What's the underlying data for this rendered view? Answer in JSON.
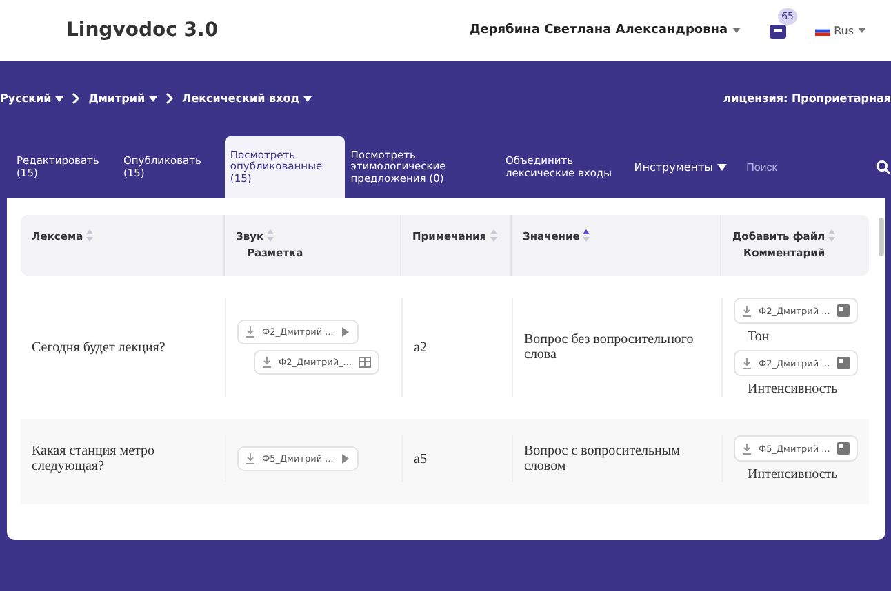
{
  "header": {
    "logo": "Lingvodoc 3.0",
    "user": "Дерябина Светлана Александровна",
    "notifications": "65",
    "language": "Rus"
  },
  "breadcrumbs": [
    "Русский",
    "Дмитрий",
    "Лексический вход"
  ],
  "license": "лицензия: Проприетарная",
  "tabs": [
    {
      "label": "Редактировать (15)",
      "selected": false
    },
    {
      "label": "Опубликовать (15)",
      "selected": false
    },
    {
      "label": "Посмотреть опубликованные (15)",
      "selected": true
    },
    {
      "label": "Посмотреть этимологические предложения (0)",
      "selected": false
    },
    {
      "label": "Объединить лексические входы",
      "selected": false
    }
  ],
  "tools": "Инструменты",
  "search": {
    "placeholder": "Поиск"
  },
  "columns": [
    {
      "label": "Лексема",
      "sorted_ascending": false
    },
    {
      "label": "Звук",
      "sub": "Разметка",
      "sorted_ascending": false
    },
    {
      "label": "Примечания",
      "sorted_ascending": false
    },
    {
      "label": "Значение",
      "sorted_ascending": true
    },
    {
      "label": "Добавить файл",
      "sub": "Комментарий",
      "sorted_ascending": false
    }
  ],
  "rows": [
    {
      "lexeme": "Сегодня будет лекция?",
      "sound": [
        {
          "file": "Ф2_Дмитрий ...",
          "kind": "audio"
        },
        {
          "file": "Ф2_Дмитрий_...",
          "kind": "markup"
        }
      ],
      "note": "а2",
      "meaning": "Вопрос без вопросительного слова",
      "files": [
        {
          "file": "Ф2_Дмитрий ...",
          "comment": "Тон"
        },
        {
          "file": "Ф2_Дмитрий ...",
          "comment": "Интенсивность"
        }
      ]
    },
    {
      "lexeme": "Какая станция метро следующая?",
      "sound": [
        {
          "file": "Ф5_Дмитрий ...",
          "kind": "audio"
        }
      ],
      "note": "а5",
      "meaning": "Вопрос с вопросительным словом",
      "files": [
        {
          "file": "Ф5_Дмитрий ...",
          "comment": "Интенсивность"
        }
      ]
    }
  ]
}
